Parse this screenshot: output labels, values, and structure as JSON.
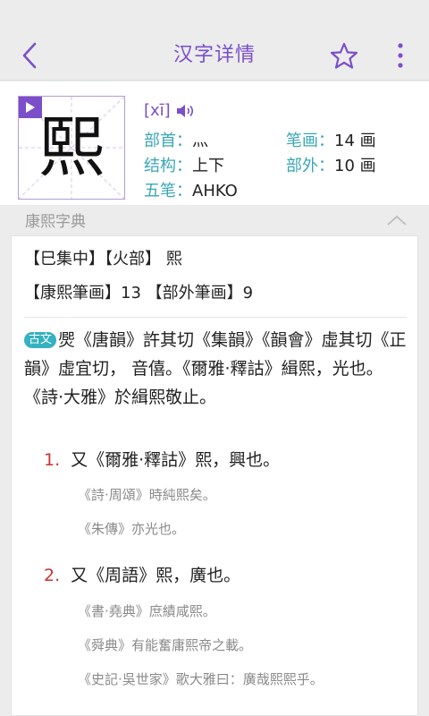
{
  "topbar": {
    "title": "汉字详情"
  },
  "header": {
    "character": "熙",
    "pinyin": "[xī]",
    "info": [
      {
        "label": "部首：",
        "value": "灬"
      },
      {
        "label": "笔画：",
        "value": "14 画"
      },
      {
        "label": "结构：",
        "value": "上下"
      },
      {
        "label": "部外：",
        "value": "10 画"
      },
      {
        "label": "五笔：",
        "value": "AHKO"
      }
    ]
  },
  "section": {
    "title": "康熙字典"
  },
  "kangxi": {
    "line1": "【巳集中】【火部】 熙",
    "line2": "【康熙筆画】13 【部外筆画】9",
    "guwen_tag": "古文",
    "guwen_text": "㷗《唐韻》許其切《集韻》《韻會》虛其切《正韻》虛宜切， 音僖。《爾雅·釋詁》緝熙，光也。《詩·大雅》於緝熙敬止。",
    "definitions": [
      {
        "num": "1.",
        "text": "又《爾雅·釋詁》熙，興也。",
        "examples": [
          "《詩·周頌》時純熙矣。",
          "《朱傳》亦光也。"
        ]
      },
      {
        "num": "2.",
        "text": "又《周語》熙，廣也。",
        "examples": [
          "《書·堯典》庶績咸熙。",
          "《舜典》有能奮庸熙帝之載。",
          "《史記·吳世家》歌大雅曰：廣哉熙熙乎。"
        ]
      }
    ]
  },
  "colors": {
    "accent": "#7b4fc9",
    "label": "#3aa6b6",
    "tag": "#35b1c0",
    "number": "#cc3333"
  }
}
